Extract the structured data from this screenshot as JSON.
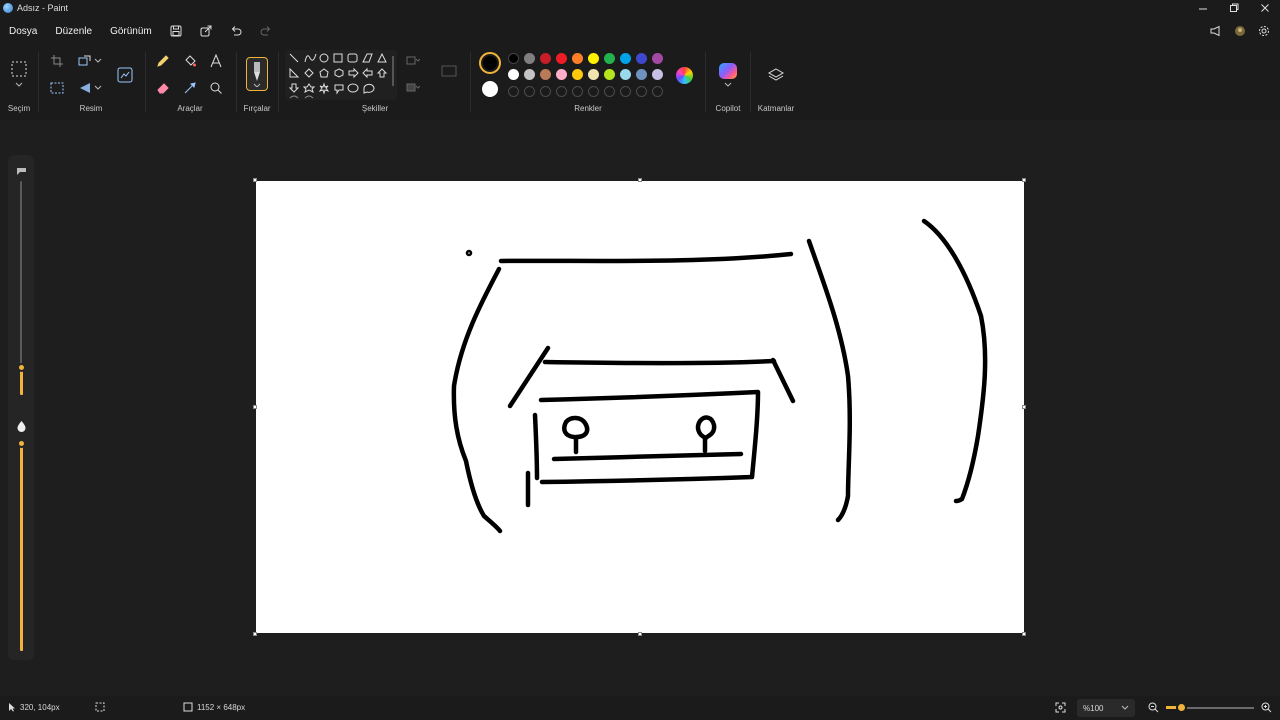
{
  "window": {
    "title": "Adsız - Paint",
    "controls": [
      "minimize-icon",
      "restore-icon",
      "close-icon"
    ]
  },
  "menu": {
    "items": [
      "Dosya",
      "Düzenle",
      "Görünüm"
    ],
    "quick_actions": [
      "save-icon",
      "share-icon",
      "undo-icon",
      "redo-icon"
    ],
    "right_icons": [
      "feedback-icon",
      "account-icon",
      "settings-icon"
    ]
  },
  "ribbon": {
    "groups": {
      "selection": "Seçim",
      "image": "Resim",
      "tools": "Araçlar",
      "brushes": "Fırçalar",
      "shapes": "Şekiller",
      "colors": "Renkler",
      "copilot": "Copilot",
      "layers": "Katmanlar"
    },
    "colors": {
      "current": "#000000",
      "secondary": "#ffffff",
      "palette_row1": [
        "#000000",
        "#7f7f7f",
        "#c81e28",
        "#ee1c24",
        "#ff7f27",
        "#fff200",
        "#22b14c",
        "#00a2e8",
        "#3f48cc",
        "#a349a4"
      ],
      "palette_row2": [
        "#ffffff",
        "#c3c3c3",
        "#b97a57",
        "#ffaec9",
        "#ffc90e",
        "#efe4b0",
        "#b5e61d",
        "#99d9ea",
        "#7092be",
        "#c8bfe7"
      ],
      "accent": "#f0b43a"
    }
  },
  "side_sliders": {
    "size_level": 0.1,
    "opacity_level": 1.0
  },
  "status": {
    "cursor_position": "320, 104px",
    "canvas_size": "1152 × 648px",
    "zoom": "%100",
    "zoom_level": 0.1
  }
}
